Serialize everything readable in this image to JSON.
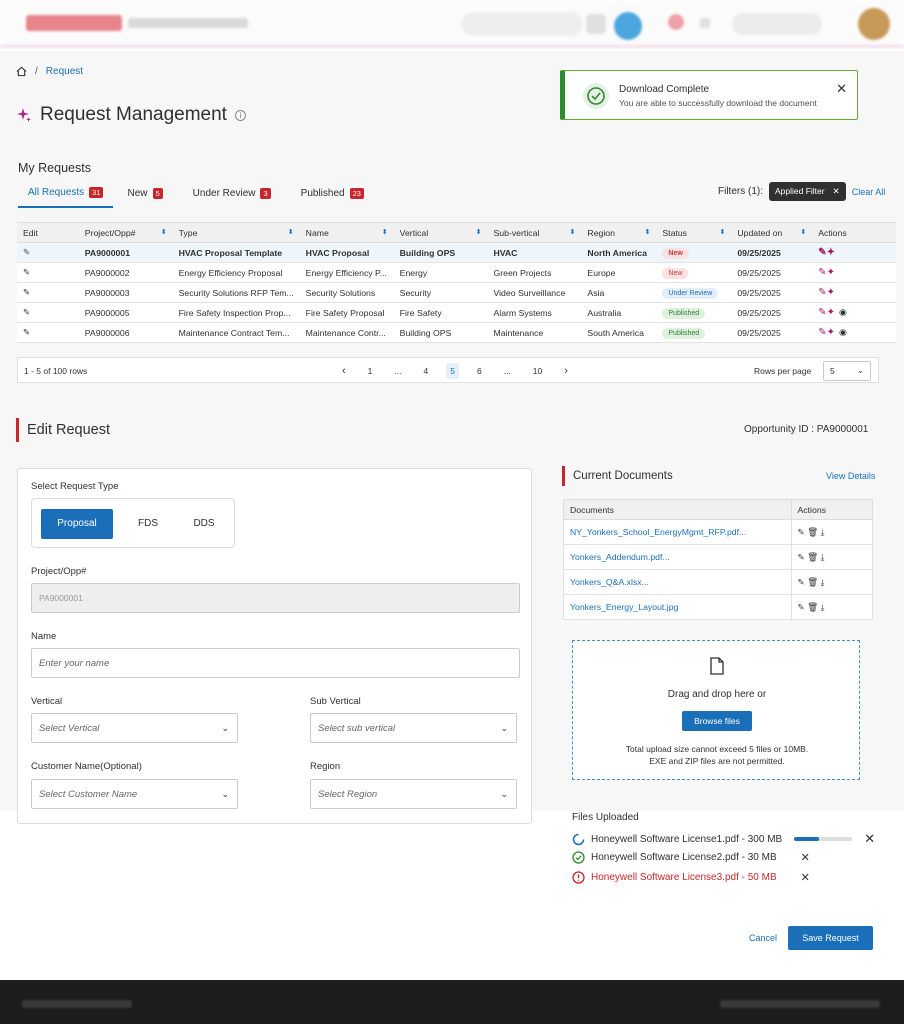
{
  "breadcrumb": {
    "current": "Request"
  },
  "page": {
    "title": "Request Management"
  },
  "toast": {
    "title": "Download Complete",
    "message": "You are able to successfully download the document"
  },
  "my_requests": {
    "heading": "My Requests",
    "tabs": [
      {
        "label": "All Requests",
        "count": "31"
      },
      {
        "label": "New",
        "count": "5"
      },
      {
        "label": "Under Review",
        "count": "3"
      },
      {
        "label": "Published",
        "count": "23"
      }
    ],
    "filters_label": "Filters (1):",
    "filter_chip": "Applied Filter",
    "clear_all": "Clear All"
  },
  "table": {
    "columns": [
      "Edit",
      "Project/Opp#",
      "Type",
      "Name",
      "Vertical",
      "Sub-vertical",
      "Region",
      "Status",
      "Updated on",
      "Actions"
    ],
    "rows": [
      {
        "id": "PA9000001",
        "type": "HVAC Proposal Template",
        "name": "HVAC Proposal",
        "vertical": "Building OPS",
        "sub": "HVAC",
        "region": "North America",
        "status": "New",
        "updated": "09/25/2025"
      },
      {
        "id": "PA9000002",
        "type": "Energy Efficiency Proposal",
        "name": "Energy Efficiency P...",
        "vertical": "Energy",
        "sub": "Green Projects",
        "region": "Europe",
        "status": "New",
        "updated": "09/25/2025"
      },
      {
        "id": "PA9000003",
        "type": "Security Solutions RFP Tem...",
        "name": "Security Solutions",
        "vertical": "Security",
        "sub": "Video Surveillance",
        "region": "Asia",
        "status": "Under Review",
        "updated": "09/25/2025"
      },
      {
        "id": "PA9000005",
        "type": "Fire Safety Inspection Prop...",
        "name": "Fire Safety Proposal",
        "vertical": "Fire Safety",
        "sub": "Alarm Systems",
        "region": "Australia",
        "status": "Published",
        "updated": "09/25/2025"
      },
      {
        "id": "PA9000006",
        "type": "Maintenance Contract Tem...",
        "name": "Maintenance Contr...",
        "vertical": "Building OPS",
        "sub": "Maintenance",
        "region": "South America",
        "status": "Published",
        "updated": "09/25/2025"
      }
    ]
  },
  "pager": {
    "range": "1 - 5 of 100 rows",
    "pages": [
      "1",
      "...",
      "4",
      "5",
      "6",
      "...",
      "10"
    ],
    "current": "5",
    "rows_label": "Rows per page",
    "rows_value": "5"
  },
  "edit": {
    "heading": "Edit Request",
    "opportunity": "Opportunity ID : PA9000001",
    "request_type_label": "Select  Request Type",
    "types": [
      "Proposal",
      "FDS",
      "DDS"
    ],
    "project_label": "Project/Opp#",
    "project_value": "PA9000001",
    "name_label": "Name",
    "name_placeholder": "Enter your name",
    "vertical_label": "Vertical",
    "vertical_placeholder": "Select Vertical",
    "subvertical_label": "Sub Vertical",
    "subvertical_placeholder": "Select sub vertical",
    "customer_label": "Customer Name(Optional)",
    "customer_placeholder": "Select Customer Name",
    "region_label": "Region",
    "region_placeholder": "Select Region"
  },
  "documents": {
    "heading": "Current Documents",
    "view_details": "View Details",
    "col_docs": "Documents",
    "col_actions": "Actions",
    "files": [
      "NY_Yonkers_School_EnergyMgmt_RFP.pdf...",
      "Yonkers_Addendum.pdf...",
      "Yonkers_Q&A.xlsx...",
      "Yonkers_Energy_Layout.jpg"
    ]
  },
  "dropzone": {
    "title": "Drag and drop here or",
    "button": "Browse files",
    "note1": "Total upload size cannot exceed 5 files or 10MB.",
    "note2": "EXE and ZIP files are not permitted."
  },
  "uploads": {
    "heading": "Files Uploaded",
    "files": [
      {
        "name": "Honeywell Software License1.pdf - 300 MB",
        "state": "uploading",
        "progress": 0.42
      },
      {
        "name": "Honeywell Software License2.pdf - 30 MB",
        "state": "done"
      },
      {
        "name": "Honeywell Software License3.pdf - 50 MB",
        "state": "error"
      }
    ]
  },
  "actions": {
    "cancel": "Cancel",
    "save": "Save Request"
  },
  "colors": {
    "primary": "#1a6fb8",
    "danger": "#c8262c",
    "success": "#2e8b2e",
    "accent": "#a11c6a"
  }
}
